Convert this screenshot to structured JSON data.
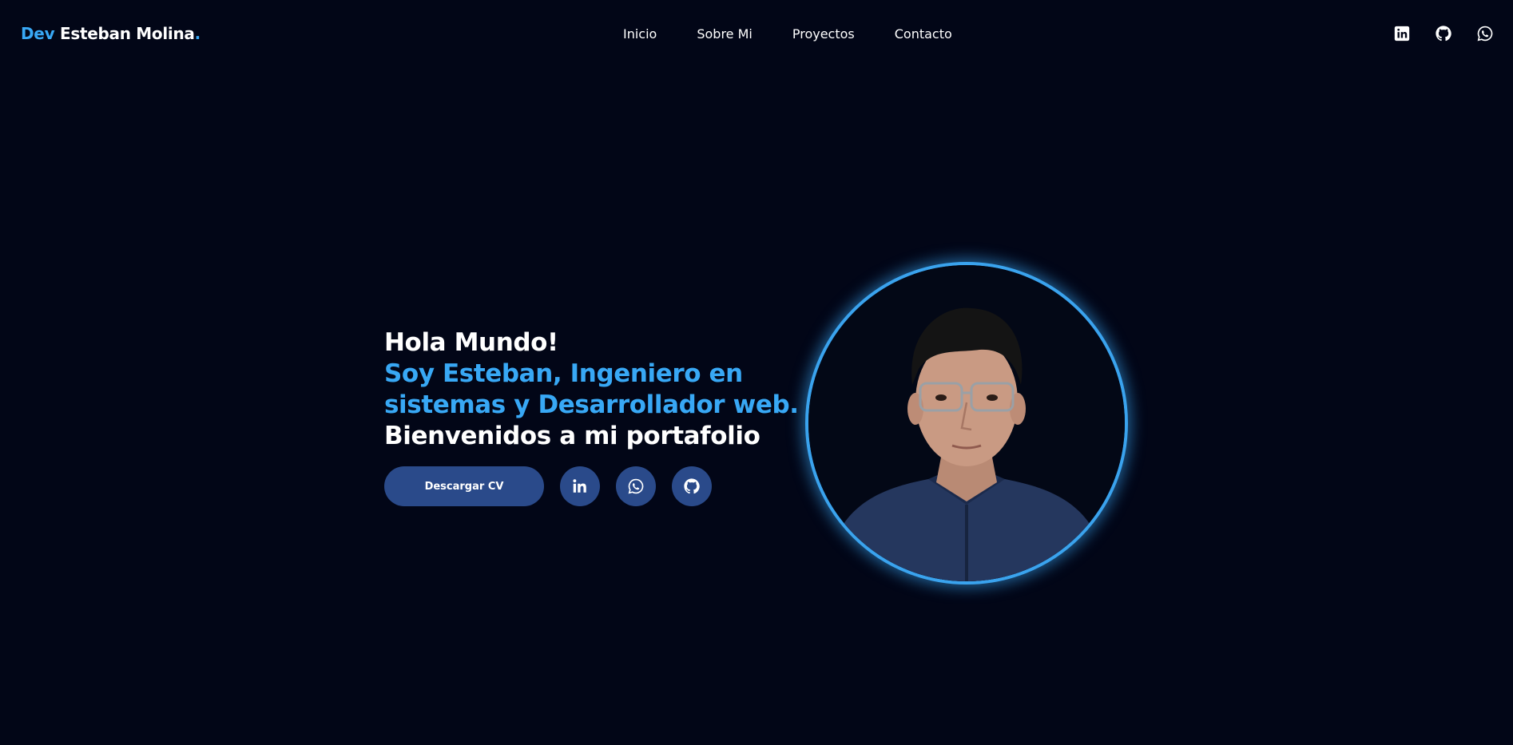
{
  "brand": {
    "prefix": "Dev",
    "name": "Esteban Molina",
    "suffix": "."
  },
  "nav": {
    "items": [
      {
        "label": "Inicio"
      },
      {
        "label": "Sobre Mi"
      },
      {
        "label": "Proyectos"
      },
      {
        "label": "Contacto"
      }
    ]
  },
  "social_top": {
    "icons": [
      "linkedin-icon",
      "github-icon",
      "whatsapp-icon"
    ]
  },
  "hero": {
    "greeting": "Hola Mundo!",
    "intro_line1": "Soy Esteban, Ingeniero en",
    "intro_line2": "sistemas y Desarrollador web.",
    "welcome": "Bienvenidos a mi portafolio",
    "cv_button": "Descargar CV",
    "social_buttons": [
      "linkedin-icon",
      "whatsapp-icon",
      "github-icon"
    ]
  },
  "colors": {
    "background": "#020617",
    "accent": "#38a8f5",
    "button": "#2a4a8a",
    "portrait_ring": "#3aa3ee"
  }
}
